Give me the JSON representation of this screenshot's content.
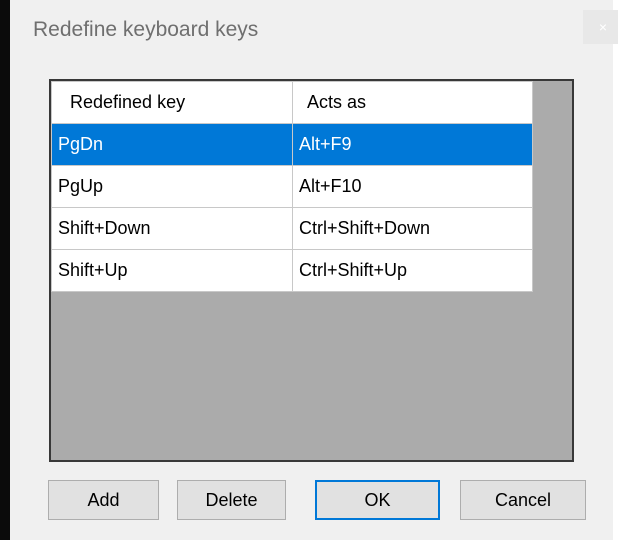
{
  "window": {
    "title": "Redefine keyboard keys",
    "close_glyph": "×"
  },
  "table": {
    "columns": [
      "Redefined key",
      "Acts as"
    ],
    "rows": [
      {
        "key": "PgDn",
        "acts_as": "Alt+F9",
        "selected": true
      },
      {
        "key": "PgUp",
        "acts_as": "Alt+F10",
        "selected": false
      },
      {
        "key": "Shift+Down",
        "acts_as": "Ctrl+Shift+Down",
        "selected": false
      },
      {
        "key": "Shift+Up",
        "acts_as": "Ctrl+Shift+Up",
        "selected": false
      }
    ]
  },
  "buttons": {
    "add": "Add",
    "delete": "Delete",
    "ok": "OK",
    "cancel": "Cancel"
  },
  "colors": {
    "selection": "#0078d7",
    "list_background": "#ababab",
    "dialog_background": "#f0f0f0",
    "default_button_border": "#0078d7"
  }
}
